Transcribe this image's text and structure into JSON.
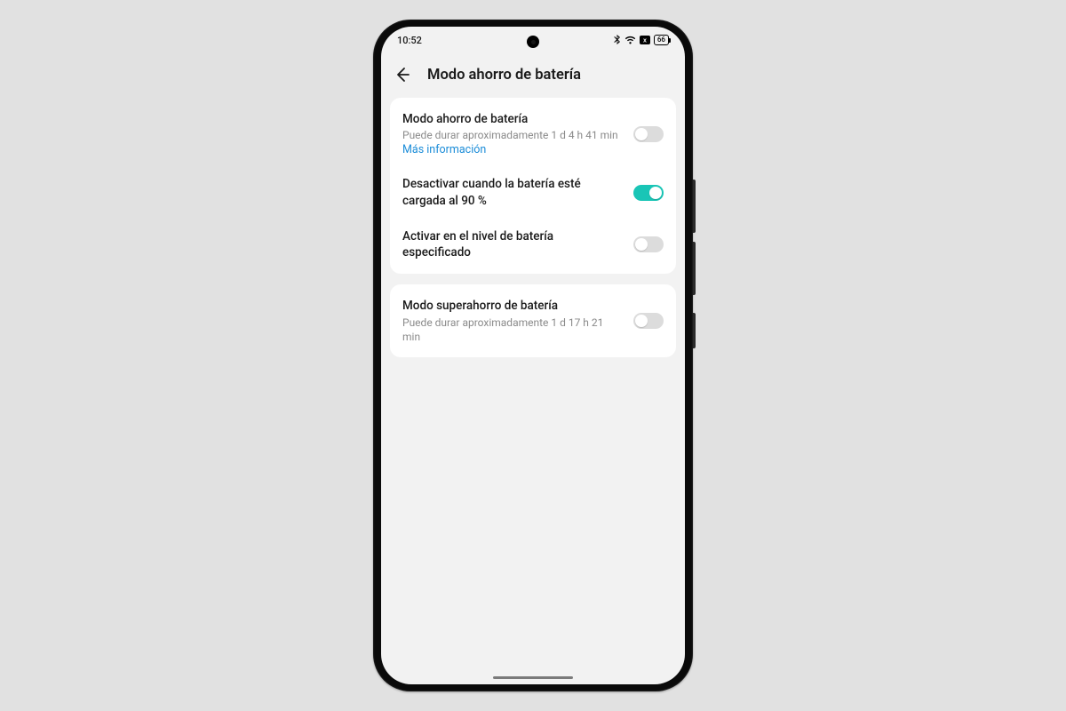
{
  "status": {
    "time": "10:52",
    "battery": "66"
  },
  "header": {
    "title": "Modo ahorro de batería"
  },
  "group1": {
    "row1": {
      "title": "Modo ahorro de batería",
      "sub": "Puede durar aproximadamente 1 d 4 h 41 min",
      "link": "Más información",
      "on": false
    },
    "row2": {
      "title": "Desactivar cuando la batería esté cargada al 90 %",
      "on": true
    },
    "row3": {
      "title": "Activar en el nivel de batería especificado",
      "on": false
    }
  },
  "group2": {
    "row1": {
      "title": "Modo superahorro de batería",
      "sub": "Puede durar aproximadamente 1 d 17 h 21 min",
      "on": false
    }
  }
}
